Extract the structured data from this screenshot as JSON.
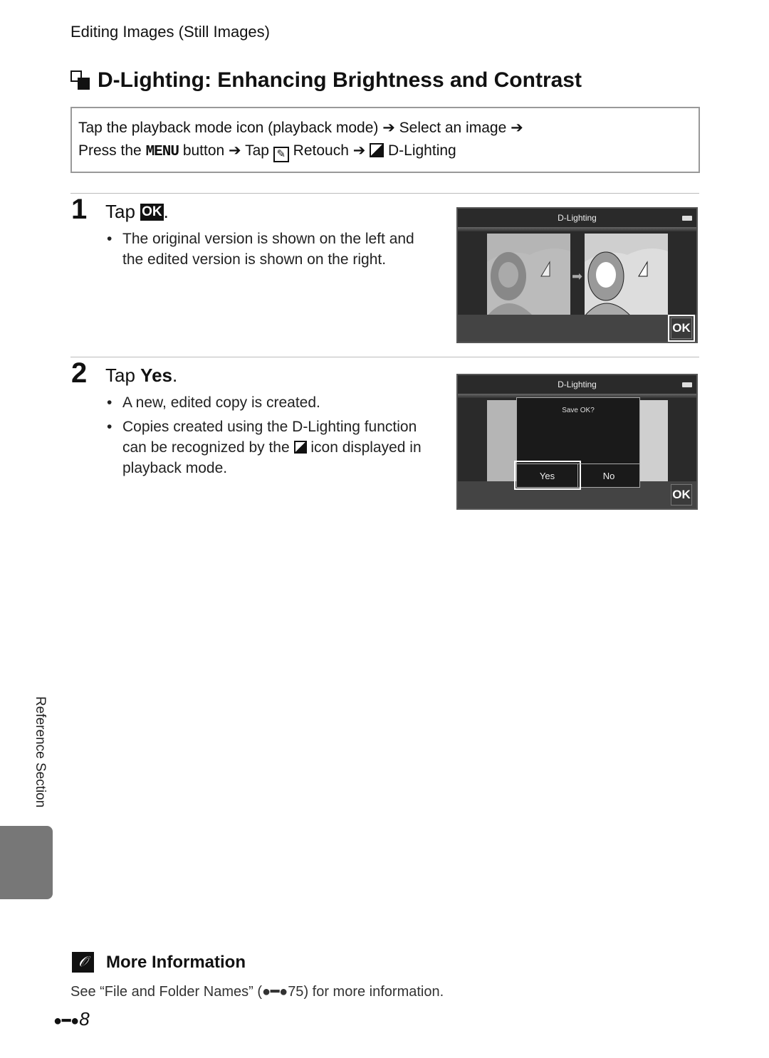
{
  "header": {
    "section": "Editing Images (Still Images)"
  },
  "title": {
    "text": "D-Lighting: Enhancing Brightness and Contrast",
    "icon": "d-lighting-icon"
  },
  "procedure": {
    "line1": "Tap the playback mode icon (playback mode) ➔ Select an image ➔",
    "line2_a": "Press the",
    "menu": "MENU",
    "line2_b": "button ➔ Tap",
    "retouch": "Retouch ➔",
    "dlighting": "D-Lighting"
  },
  "steps": [
    {
      "number": "1",
      "label": "Tap",
      "label_icon": "OK",
      "label_end": ".",
      "bullets": [
        "The original version is shown on the left and the edited version is shown on the right."
      ],
      "screen": {
        "title": "D-Lighting",
        "ok": "OK"
      }
    },
    {
      "number": "2",
      "label": "Tap",
      "label_bold": "Yes",
      "label_end": ".",
      "bullets": [
        "A new, edited copy is created.",
        "Copies created using the D-Lighting function can be recognized by the",
        "icon displayed in playback mode."
      ],
      "screen": {
        "title": "D-Lighting",
        "dialog": "Save OK?",
        "yes": "Yes",
        "no": "No",
        "ok": "OK"
      }
    }
  ],
  "sidebar": {
    "label": "Reference Section"
  },
  "more_info": {
    "title": "More Information",
    "text_a": "See “File and Folder Names” (",
    "ref": "75",
    "text_b": ") for more information."
  },
  "page": {
    "number": "8"
  }
}
